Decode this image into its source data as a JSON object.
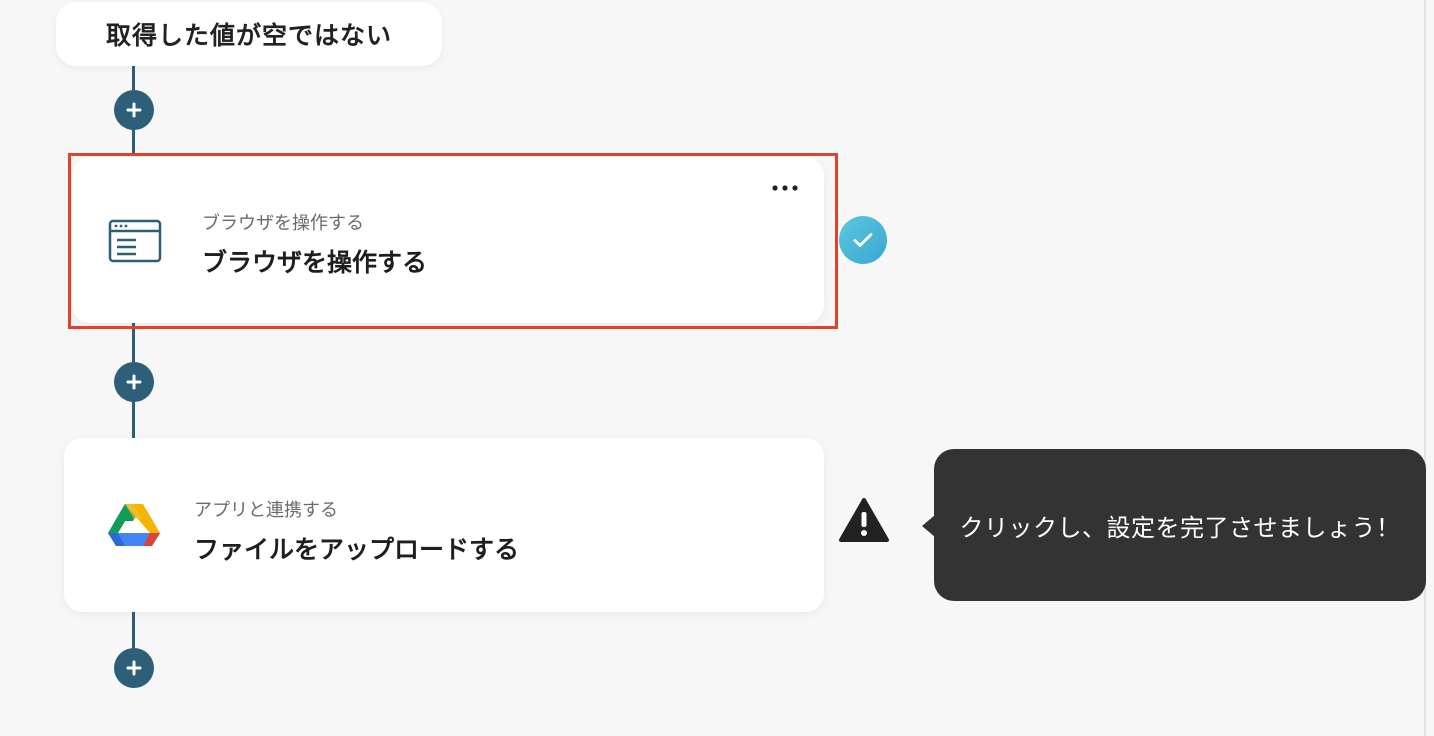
{
  "condition": {
    "label": "取得した値が空ではない"
  },
  "steps": [
    {
      "subtitle": "ブラウザを操作する",
      "title": "ブラウザを操作する",
      "icon": "browser-window-icon",
      "status": "complete",
      "selected": true
    },
    {
      "subtitle": "アプリと連携する",
      "title": "ファイルをアップロードする",
      "icon": "google-drive-icon",
      "status": "warning"
    }
  ],
  "tooltip": {
    "text": "クリックし、設定を完了させましょう！"
  },
  "colors": {
    "flow": "#2e5f78",
    "selection": "#e2412a",
    "check": "#3aa6d2",
    "tooltip_bg": "#333333",
    "background": "#f7f7f7"
  }
}
